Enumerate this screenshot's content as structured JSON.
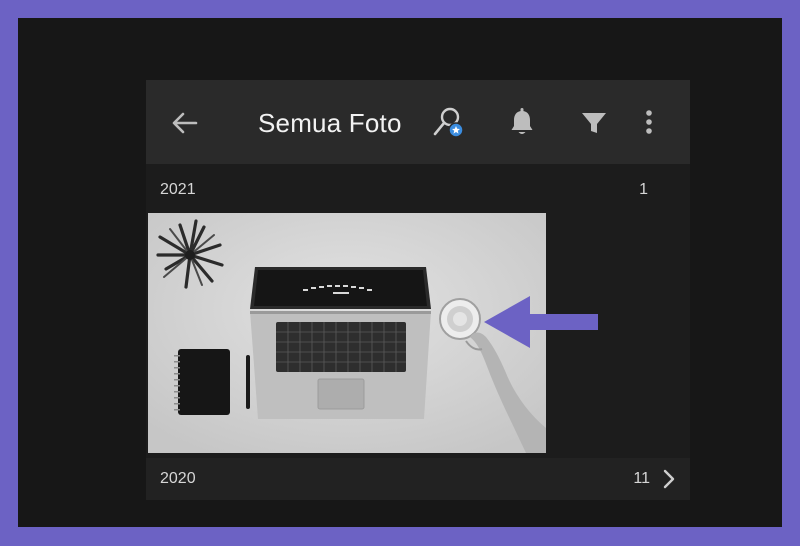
{
  "header": {
    "title": "Semua Foto",
    "icons": [
      "back-arrow-icon",
      "people-search-icon",
      "bell-icon",
      "filter-icon",
      "more-vertical-icon"
    ]
  },
  "sections": [
    {
      "year": "2021",
      "count": "1"
    },
    {
      "year": "2020",
      "count": "11"
    }
  ],
  "colors": {
    "frame": "#6c62c4",
    "background": "#171717",
    "topbar": "#2a2a2a",
    "badge": "#3b8de0",
    "pointer_arrow": "#6c62c4"
  }
}
